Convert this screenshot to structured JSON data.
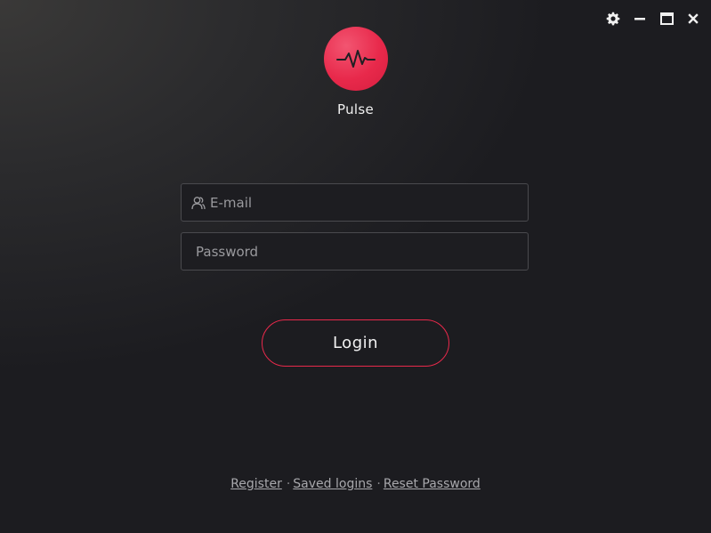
{
  "window": {
    "controls": {
      "settings_icon": "gear-icon",
      "minimize_icon": "minimize-icon",
      "maximize_icon": "maximize-icon",
      "close_icon": "close-icon"
    }
  },
  "app": {
    "name": "Pulse",
    "logo_icon": "heartbeat-icon",
    "accent_color": "#e8294b"
  },
  "form": {
    "email": {
      "placeholder": "E-mail",
      "value": "",
      "icon": "user-icon"
    },
    "password": {
      "placeholder": "Password",
      "value": ""
    },
    "login_label": "Login"
  },
  "footer": {
    "register_label": "Register",
    "saved_logins_label": "Saved logins",
    "reset_password_label": "Reset Password",
    "separator": "·"
  }
}
